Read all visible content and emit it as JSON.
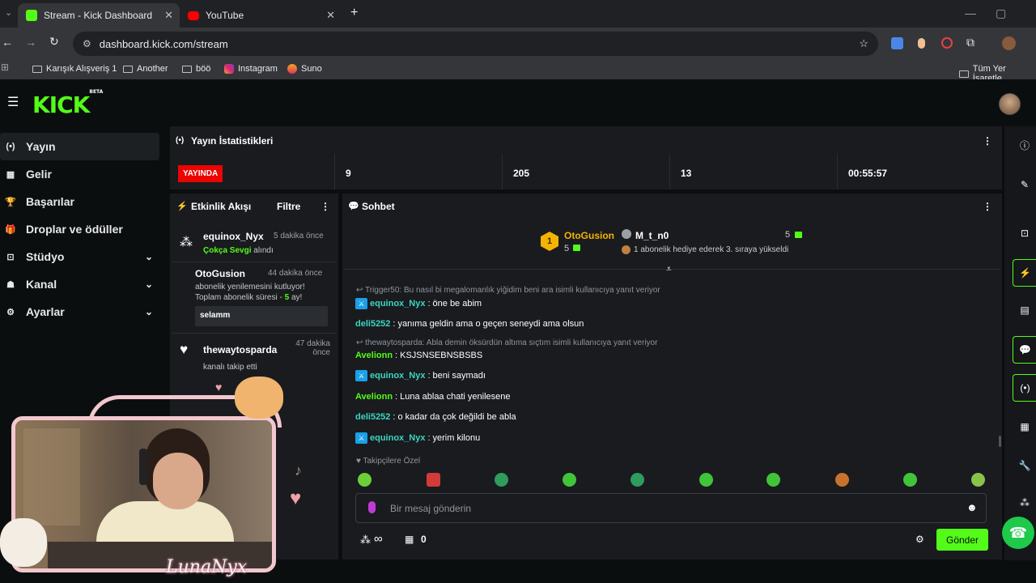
{
  "browser": {
    "tabs": [
      {
        "title": "Stream - Kick Dashboard",
        "close": "✕"
      },
      {
        "title": "YouTube",
        "close": "✕"
      }
    ],
    "new_tab": "+",
    "url": "dashboard.kick.com/stream",
    "bookmarks": [
      "Karışık Alışveriş 1",
      "Another",
      "böö",
      "Instagram",
      "Suno"
    ],
    "all_bookmarks": "Tüm Yer İşaretle"
  },
  "kick": {
    "logo": "KICK",
    "logo_badge": "BETA",
    "sidebar": [
      {
        "label": "Yayın",
        "icon": "(•)",
        "active": true
      },
      {
        "label": "Gelir",
        "icon": "▦"
      },
      {
        "label": "Başarılar",
        "icon": "🏆"
      },
      {
        "label": "Droplar ve ödüller",
        "icon": "🎁"
      },
      {
        "label": "Stüdyo",
        "icon": "⊡",
        "expand": "⌄"
      },
      {
        "label": "Kanal",
        "icon": "☗",
        "expand": "⌄"
      },
      {
        "label": "Ayarlar",
        "icon": "⚙",
        "expand": "⌄"
      }
    ],
    "stats": {
      "title": "Yayın İstatistikleri",
      "live": "YAYINDA",
      "values": [
        "9",
        "205",
        "13",
        "00:55:57"
      ]
    },
    "activity": {
      "title": "Etkinlik Akışı",
      "filter": "Filtre",
      "items": [
        {
          "name": "equinox_Nyx",
          "time": "5 dakika önce",
          "gift": "Çokça Sevgi",
          "text": " alındı"
        },
        {
          "name": "OtoGusion",
          "time": "44 dakika önce",
          "line1": "abonelik yenilemesini kutluyor!",
          "line2a": "Toplam abonelik süresi - ",
          "line2b": "5",
          "line2c": " ay!",
          "message": "selamm"
        },
        {
          "name": "thewaytosparda",
          "time": "47 dakika önce",
          "text": "kanalı takip etti"
        }
      ]
    },
    "chat": {
      "title": "Sohbet",
      "pinned": {
        "rank": "1",
        "user1": "OtoGusion",
        "user1_count": "5",
        "user2": "M_t_n0",
        "user2_count": "5",
        "user2_text": "1 abonelik hediye ederek 3. sıraya yükseldi"
      },
      "messages": [
        {
          "reply": "Trigger50: Bu nasıl bi megalomanlık yiğidim beni ara isimli kullanıcıya yanıt veriyor"
        },
        {
          "user": "equinox_Nyx",
          "badge": true,
          "text": "öne be abim",
          "color": "#3dd6c0"
        },
        {
          "user": "deli5252",
          "text": "yanıma geldin ama o geçen seneydi ama olsun",
          "color": "#3dd6c0"
        },
        {
          "reply": "thewaytosparda: Abla demin öksürdün altıma sıçtım isimli kullanıcıya yanıt veriyor"
        },
        {
          "user": "Avelionn",
          "text": "KSJSNSEBNSBSBS",
          "color": "#53fc18"
        },
        {
          "user": "equinox_Nyx",
          "badge": true,
          "text": "beni saymadı",
          "color": "#3dd6c0"
        },
        {
          "user": "Avelionn",
          "text": "Luna ablaa chati yenilesene",
          "color": "#53fc18"
        },
        {
          "user": "deli5252",
          "text": "o kadar da çok değildi be abla",
          "color": "#3dd6c0"
        },
        {
          "user": "equinox_Nyx",
          "badge": true,
          "text": "yerim kilonu",
          "color": "#3dd6c0"
        }
      ],
      "emote_label": "Takipçilere Özel",
      "input_placeholder": "Bir mesaj gönderin",
      "points": "∞",
      "store_count": "0",
      "send": "Gönder"
    },
    "webcam_name": "LunaNyx"
  },
  "colors": {
    "kick_green": "#53fc18",
    "live_red": "#eb0400",
    "panel": "#191b1f"
  }
}
